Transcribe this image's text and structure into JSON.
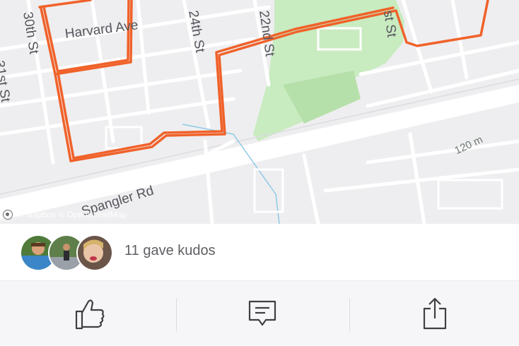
{
  "map": {
    "street_labels": {
      "harvard_ave": "Harvard Ave",
      "st_30th": "30th St",
      "st_31st": "31st St",
      "st_24th": "24th St",
      "st_22nd": "22nd St",
      "st_partial": "st St",
      "spangler_rd": "Spangler Rd"
    },
    "scale_label": "120 m",
    "attribution": "© Mapbox © OpenStreetMap",
    "route_color": "#f0622a",
    "park_color": "#c9ebc0"
  },
  "kudos": {
    "text": "11 gave kudos",
    "avatars": [
      "avatar-1",
      "avatar-2",
      "avatar-3"
    ]
  },
  "actions": {
    "kudos_icon": "thumbs-up-icon",
    "comment_icon": "comment-icon",
    "share_icon": "share-icon"
  }
}
